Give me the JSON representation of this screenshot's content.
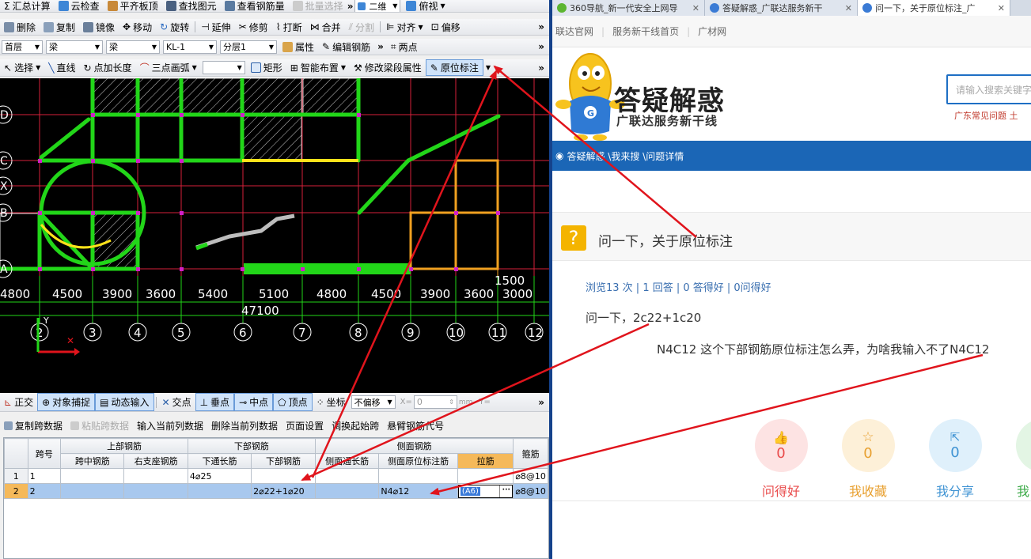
{
  "toolbar1": {
    "items": [
      "汇总计算",
      "云检查",
      "平齐板顶",
      "查找图元",
      "查看钢筋量",
      "批量选择",
      "二维",
      "俯视"
    ]
  },
  "toolbar2": {
    "items": [
      "删除",
      "复制",
      "镜像",
      "移动",
      "旋转",
      "延伸",
      "修剪",
      "打断",
      "合并",
      "分割",
      "对齐",
      "偏移"
    ]
  },
  "toolbar3": {
    "floor": "首层",
    "type": "梁",
    "subtype": "梁",
    "element": "KL-1",
    "layer": "分层1",
    "attr": "属性",
    "edit": "编辑钢筋",
    "twopoint": "两点"
  },
  "toolbar4": {
    "items": [
      "选择",
      "直线",
      "点加长度",
      "三点画弧",
      "",
      "矩形",
      "智能布置",
      "修改梁段属性",
      "原位标注"
    ]
  },
  "canvas": {
    "axis_letters": [
      "D",
      "C",
      "X",
      "B",
      "A"
    ],
    "dims": [
      "4800",
      "4500",
      "3900",
      "3600",
      "5400",
      "5100",
      "4800",
      "4500",
      "3900",
      "3600",
      "3000"
    ],
    "total": "47100",
    "dim_extra": "1500",
    "axis_numbers": [
      "2",
      "3",
      "4",
      "5",
      "6",
      "7",
      "8",
      "9",
      "10",
      "11",
      "12"
    ],
    "ucs_y": "Y"
  },
  "statusbar": {
    "items": [
      "正交",
      "对象捕捉",
      "动态输入",
      "交点",
      "垂点",
      "中点",
      "顶点",
      "坐标",
      "不偏移"
    ],
    "x_label": "X=",
    "x_value": "0",
    "unit": "mm",
    "y_label": "Y="
  },
  "gridtoolbar": {
    "items": [
      "复制跨数据",
      "粘贴跨数据",
      "输入当前列数据",
      "删除当前列数据",
      "页面设置",
      "调换起始跨",
      "悬臂钢筋代号"
    ]
  },
  "table": {
    "group_headers": {
      "span": "跨号",
      "top": "上部钢筋",
      "bottom": "下部钢筋",
      "side": "侧面钢筋",
      "stirrup": "箍筋"
    },
    "sub_headers": [
      "跨中钢筋",
      "右支座钢筋",
      "下通长筋",
      "下部钢筋",
      "侧面通长筋",
      "侧面原位标注筋",
      "拉筋"
    ],
    "rows": [
      {
        "n": "1",
        "span": "1",
        "mid": "",
        "right": "",
        "bot_through": "4⌀25",
        "bot": "",
        "side_through": "",
        "side_orig": "",
        "tie": "",
        "stirrup": "⌀8@10"
      },
      {
        "n": "2",
        "span": "2",
        "mid": "",
        "right": "",
        "bot_through": "",
        "bot": "2⌀22+1⌀20",
        "side_through": "",
        "side_orig": "N4⌀12",
        "tie": "(A6)",
        "stirrup": "⌀8@10"
      }
    ]
  },
  "browser": {
    "tabs": [
      {
        "title": "360导航_新一代安全上网导"
      },
      {
        "title": "答疑解惑_广联达服务新干"
      },
      {
        "title": "问一下，关于原位标注_广"
      }
    ],
    "topnav": [
      "联达官网",
      "服务新干线首页",
      "广材网"
    ],
    "logo_title": "答疑解惑",
    "logo_sub": "广联达服务新干线",
    "search_placeholder": "请输入搜索关键字",
    "header_links": "广东常见问题    土",
    "breadcrumb": "答疑解惑 \\我来搜 \\问题详情",
    "question_title": "问一下，关于原位标注",
    "stats": "浏览13 次 | 1 回答 | 0 答得好 | 0问得好",
    "body1": "问一下，2c22+1c20",
    "body2": "N4C12    这个下部钢筋原位标注怎么弄，为啥我输入不了N4C12",
    "actions": [
      {
        "label": "问得好",
        "count": "0",
        "color": "#e94b4b",
        "bg": "#fde3e3",
        "icon": "thumb-up-icon"
      },
      {
        "label": "我收藏",
        "count": "0",
        "color": "#e8a030",
        "bg": "#fdf0d8",
        "icon": "star-icon"
      },
      {
        "label": "我分享",
        "count": "0",
        "color": "#3f93d3",
        "bg": "#dff0fb",
        "icon": "share-icon"
      },
      {
        "label": "我",
        "count": "",
        "color": "#3caa48",
        "bg": "#e3f5e4",
        "icon": "more-icon"
      }
    ]
  },
  "colors": {
    "arrow": "#e0141c",
    "canvas_bg": "#000000",
    "brand_blue": "#1b66b6"
  }
}
